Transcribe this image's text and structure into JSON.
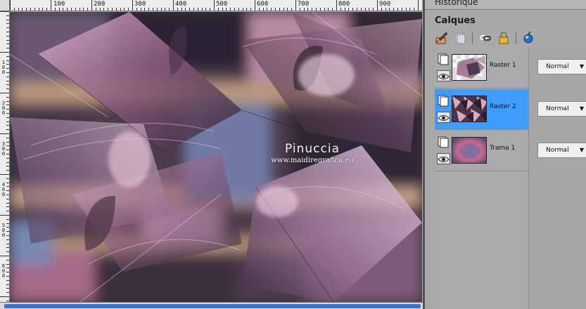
{
  "panels": {
    "history_title": "Historique",
    "layers_title": "Calques"
  },
  "toolbar": {
    "icons": [
      "new-layer-brush-icon",
      "duplicate-layer-icon",
      "link-icon",
      "lock-icon",
      "layer-properties-icon"
    ]
  },
  "rulers": {
    "top_labels": [
      "100",
      "200",
      "300",
      "400",
      "500",
      "600",
      "700",
      "800",
      "900"
    ],
    "left_labels": [
      "100",
      "200",
      "300",
      "400",
      "500",
      "600"
    ]
  },
  "layers": [
    {
      "name": "Raster 1",
      "blend": "Normal",
      "selected": false,
      "thumb": "checker-mosaic"
    },
    {
      "name": "Raster 2",
      "blend": "Normal",
      "selected": true,
      "thumb": "mosaic"
    },
    {
      "name": "Trama 1",
      "blend": "Normal",
      "selected": false,
      "thumb": "radial-gradient"
    }
  ],
  "watermark": {
    "name": "Pinuccia",
    "url": "www.maidiregrafica.eu"
  },
  "colors": {
    "selection": "#3e9cff",
    "scroll_thumb": "#3d6fd8"
  }
}
